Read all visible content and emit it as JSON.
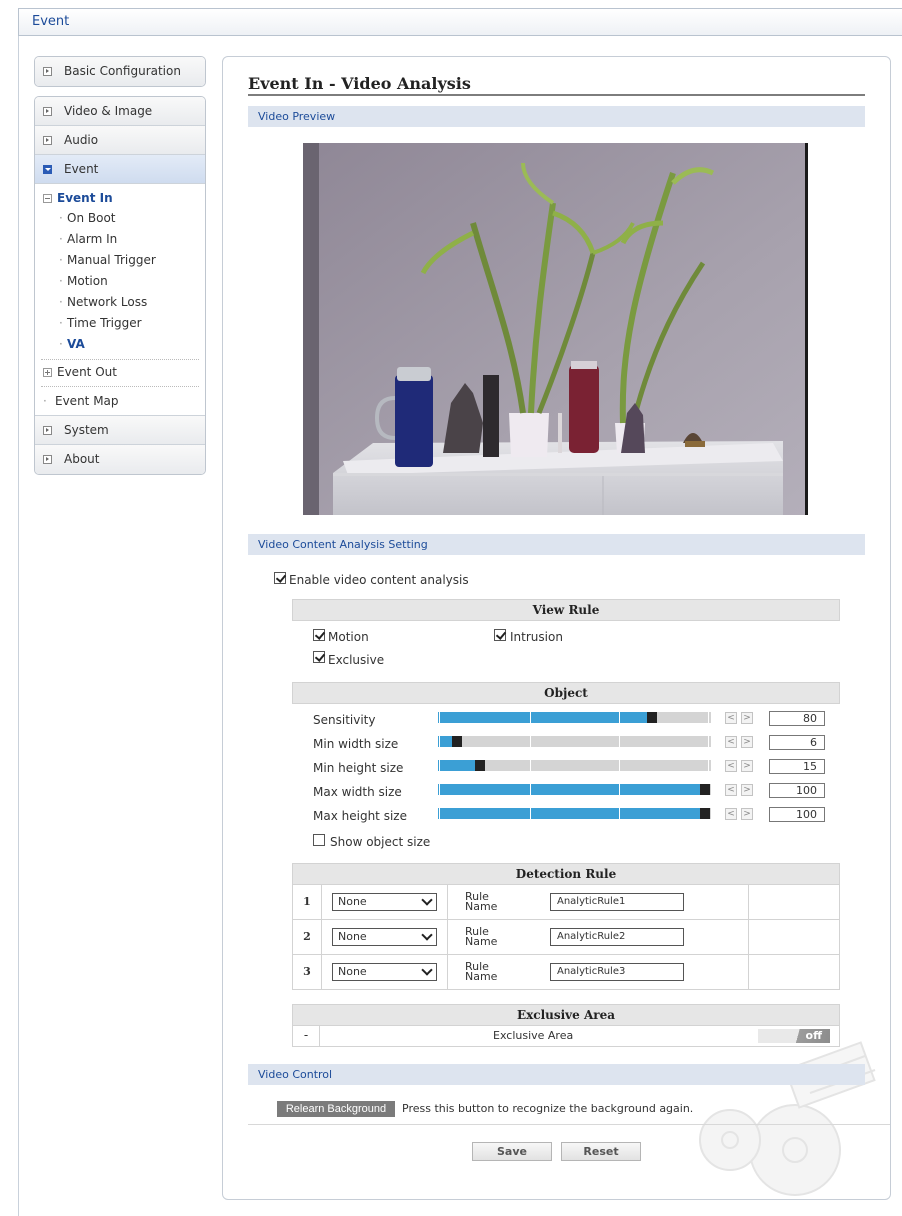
{
  "header": {
    "title": "Event"
  },
  "sidebar": {
    "basic_configuration": "Basic Configuration",
    "video_image": "Video & Image",
    "audio": "Audio",
    "event": "Event",
    "event_in": "Event In",
    "event_in_items": [
      "On Boot",
      "Alarm In",
      "Manual Trigger",
      "Motion",
      "Network Loss",
      "Time Trigger",
      "VA"
    ],
    "event_out": "Event Out",
    "event_map": "Event Map",
    "system": "System",
    "about": "About"
  },
  "main": {
    "title": "Event In - Video Analysis",
    "video_preview_label": "Video Preview",
    "vca_setting_label": "Video Content Analysis Setting",
    "enable_label": "Enable video content analysis",
    "enable_checked": true,
    "view_rule": {
      "heading": "View Rule",
      "motion": "Motion",
      "intrusion": "Intrusion",
      "exclusive": "Exclusive"
    },
    "object": {
      "heading": "Object",
      "sensitivity_label": "Sensitivity",
      "sensitivity_value": "80",
      "min_width_label": "Min width size",
      "min_width_value": "6",
      "min_height_label": "Min height size",
      "min_height_value": "15",
      "max_width_label": "Max width size",
      "max_width_value": "100",
      "max_height_label": "Max height size",
      "max_height_value": "100",
      "show_object_size_label": "Show object size",
      "dec_symbol": "<",
      "inc_symbol": ">"
    },
    "detection_rule": {
      "heading": "Detection Rule",
      "rule_name_label": "Rule Name",
      "rows": [
        {
          "num": "1",
          "type": "None",
          "name": "AnalyticRule1"
        },
        {
          "num": "2",
          "type": "None",
          "name": "AnalyticRule2"
        },
        {
          "num": "3",
          "type": "None",
          "name": "AnalyticRule3"
        }
      ]
    },
    "exclusive_area": {
      "heading": "Exclusive Area",
      "dash": "-",
      "label": "Exclusive Area",
      "toggle": "off"
    },
    "video_control": {
      "label": "Video Control",
      "relearn_button": "Relearn Background",
      "relearn_hint": "Press this button to recognize the background again."
    },
    "save_button": "Save",
    "reset_button": "Reset"
  },
  "colors": {
    "accent": "#1c4b99",
    "slider_fill": "#3b9fd5",
    "section_bg": "#dde4ef"
  }
}
